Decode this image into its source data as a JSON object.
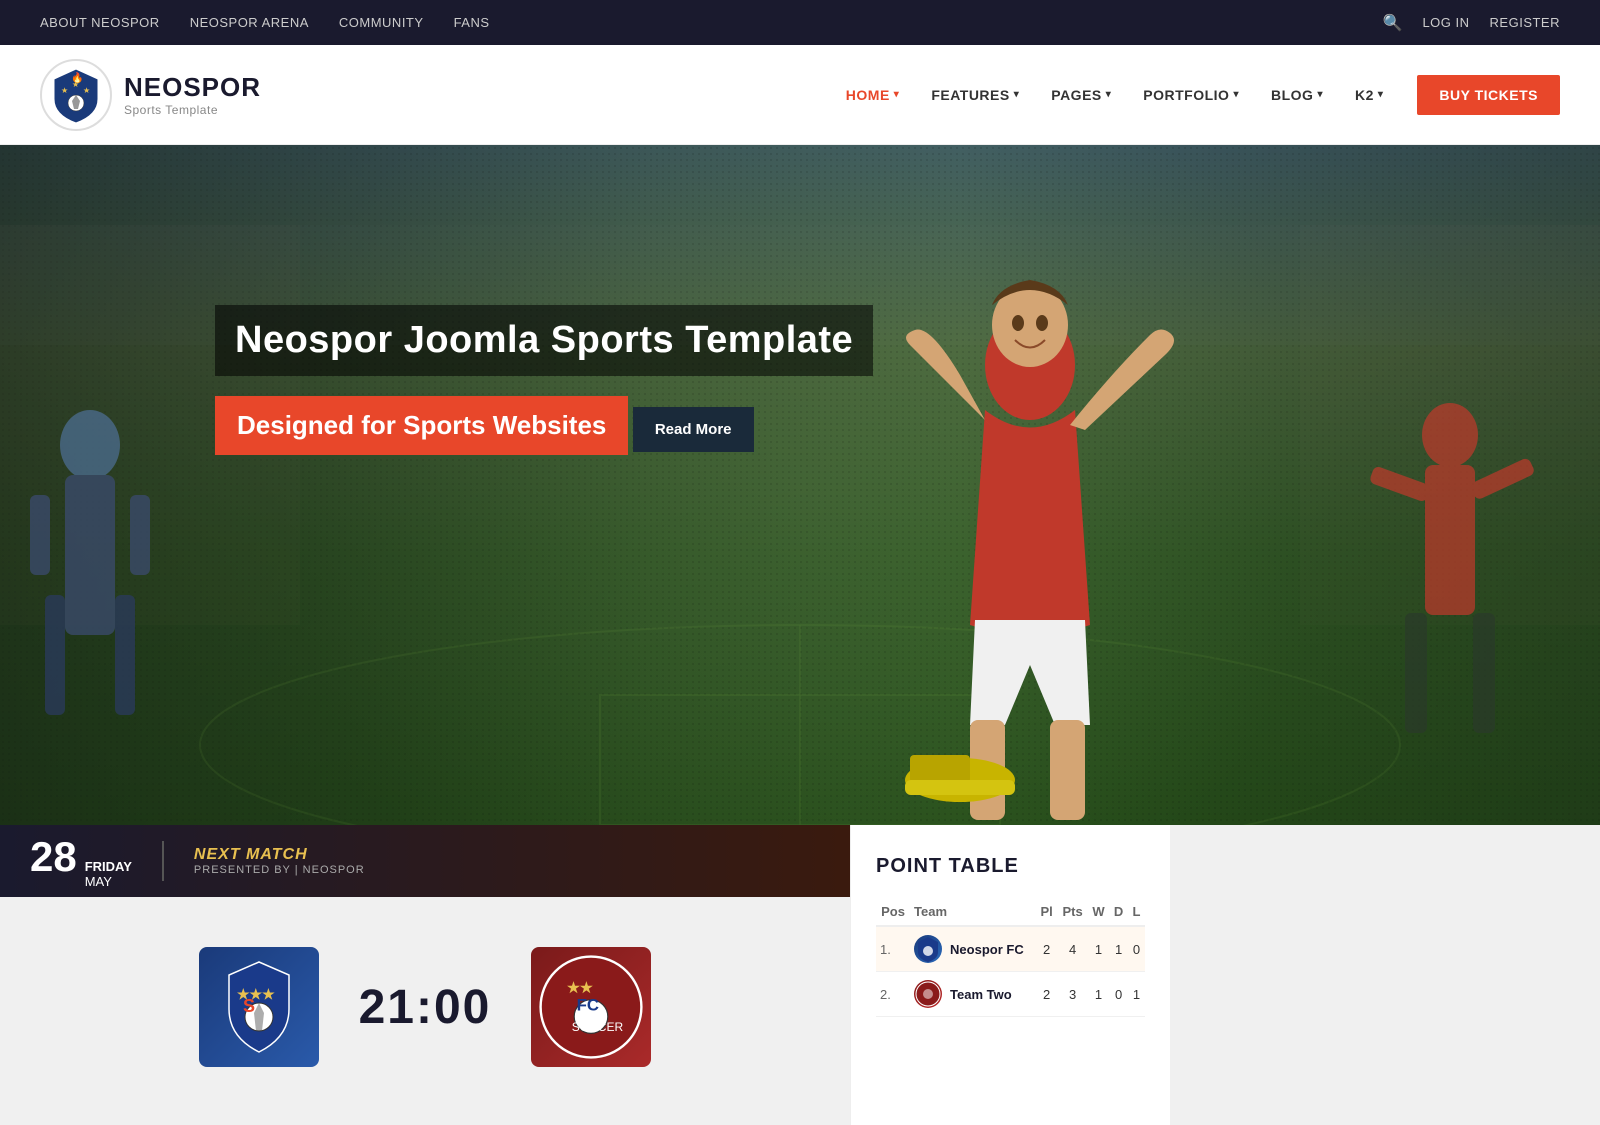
{
  "topNav": {
    "links": [
      "ABOUT NEOSPOR",
      "NEOSPOR ARENA",
      "COMMUNITY",
      "FANS"
    ],
    "rightLinks": [
      "LOG IN",
      "REGISTER"
    ]
  },
  "mainNav": {
    "logoName": "NEOSPOR",
    "logoSub": "Sports Template",
    "menuItems": [
      {
        "label": "HOME",
        "active": true,
        "hasDropdown": true
      },
      {
        "label": "FEATURES",
        "active": false,
        "hasDropdown": true
      },
      {
        "label": "PAGES",
        "active": false,
        "hasDropdown": true
      },
      {
        "label": "PORTFOLIO",
        "active": false,
        "hasDropdown": true
      },
      {
        "label": "BLOG",
        "active": false,
        "hasDropdown": true
      },
      {
        "label": "K2",
        "active": false,
        "hasDropdown": true
      }
    ],
    "buyTickets": "BUY TICKETS"
  },
  "hero": {
    "title": "Neospor Joomla Sports Template",
    "subtitle": "Designed for Sports Websites",
    "btnLabel": "Read More"
  },
  "nextMatch": {
    "dayNum": "28",
    "dayName": "FRIDAY",
    "month": "MAY",
    "title": "NEXT MATCH",
    "subtitle": "PRESENTED BY | NEOSPOR",
    "time": "21:00"
  },
  "pointTable": {
    "title": "POINT TABLE",
    "headers": [
      "Pos",
      "Team",
      "Pl",
      "Pts",
      "W",
      "D",
      "L"
    ],
    "rows": [
      {
        "pos": "1.",
        "team": "Neospor FC",
        "pl": "2",
        "pts": "4",
        "w": "1",
        "d": "1",
        "l": "0"
      },
      {
        "pos": "2.",
        "team": "Team Two",
        "pl": "2",
        "pts": "3",
        "w": "1",
        "d": "0",
        "l": "1"
      }
    ]
  }
}
